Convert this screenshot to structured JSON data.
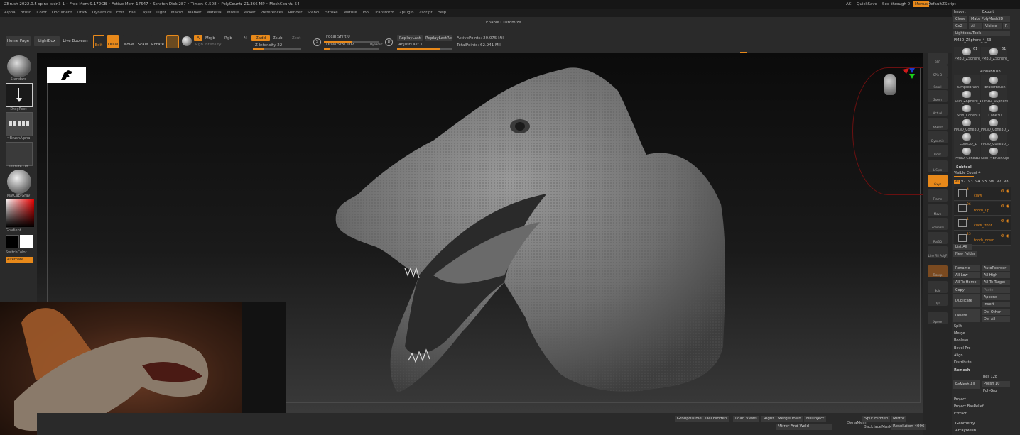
{
  "titlebar": {
    "text": "ZBrush 2022.0.5    spino_skin3-1    • Free Mem 9.172GB • Active Mem 17547 • Scratch Disk 287 • Timer▸ 0.508 • PolyCount▸ 21.366 MP • MeshCount▸ 54",
    "ac": "AC",
    "quicksave": "QuickSave",
    "see_through": "See-through 0",
    "menus": "Menus",
    "default_script": "DefaultZScript"
  },
  "menubar": [
    "Alpha",
    "Brush",
    "Color",
    "Document",
    "Draw",
    "Dynamics",
    "Edit",
    "File",
    "Layer",
    "Light",
    "Macro",
    "Marker",
    "Material",
    "Movie",
    "Picker",
    "Preferences",
    "Render",
    "Stencil",
    "Stroke",
    "Texture",
    "Tool",
    "Transform",
    "Zplugin",
    "Zscript",
    "Help"
  ],
  "enable_customize": "Enable Customize",
  "toolbar": {
    "home_page": "Home Page",
    "lightbox": "LightBox",
    "live_boolean": "Live Boolean",
    "edit": "Edit",
    "draw": "Draw",
    "move": "Move",
    "scale": "Scale",
    "rotate": "Rotate",
    "a": "A",
    "mrgb": "Mrgb",
    "rgb": "Rgb",
    "m": "M",
    "zadd": "Zadd",
    "zsub": "Zsub",
    "zcut": "Zcut",
    "rgb_intensity": "Rgb Intensity",
    "z_intensity": "Z Intensity 22",
    "z_intensity_value": 0.22,
    "focal_shift": "Focal Shift 0",
    "draw_size": "Draw Size 102",
    "dynamic": "Dynamic",
    "replay_last": "ReplayLast",
    "replay_last_rel": "ReplayLastRel",
    "adjust_last": "AdjustLast 1",
    "active_points": "ActivePoints: 20.075 Mil",
    "total_points": "TotalPoints: 62.941 Mil",
    "s": "S",
    "d": "D"
  },
  "left_shelf": {
    "standard": "Standard",
    "drag_rect": "DragRect",
    "brush_alpha": "~BrushAlpha",
    "texture_off": "Texture Off",
    "matcap": "MatCap Gray",
    "gradient": "Gradient",
    "switch_color": "SwitchColor",
    "alternate": "Alternate"
  },
  "right_shelf": [
    "BPR",
    "SPix 3",
    "Scroll",
    "Zoom",
    "Actual",
    "AAHalf",
    "Dynamic Persp",
    "Floor",
    "L.Sym",
    "Gxyz",
    "Frame",
    "Move",
    "Zoom3D",
    "Rot3D",
    "Line Fill PolyF",
    "Transp",
    "Solo",
    "Dyn",
    "Xpose"
  ],
  "panel": {
    "import": "Import",
    "export": "Export",
    "clone": "Clone",
    "make_polymesh": "Make PolyMesh3D",
    "goz": "GoZ",
    "all": "All",
    "visible": "Visible",
    "r": "R",
    "lightbox_tools": "Lightbox▸Tools",
    "current_tool": "PM3D_ZSphere_4_53",
    "thumbs": [
      "PM3D_ZSphere_",
      "PM3D_ZSphere_",
      "SimpleBrush",
      "EraserBrush",
      "Skin_ZSphere_1",
      "PM3D_ZSphere",
      "Skin_Cone3D",
      "Cone3D",
      "PM3D_Cone3D_1",
      "PM3D_Cone3D_2",
      "Cone3D_1",
      "PM3D_Cone3D_1",
      "PM3D_Cone3D_",
      "Skin_~BrushAlph"
    ],
    "thumb_counts": [
      "61",
      "61"
    ],
    "alphabrush": "AlphaBrush",
    "subtool": "Subtool",
    "visible_count": "Visible Count 4",
    "versions": [
      "V1",
      "V2",
      "V3",
      "V4",
      "V5",
      "V6",
      "V7",
      "V8"
    ],
    "subtools": [
      {
        "num": "4",
        "name": "claw"
      },
      {
        "num": "26",
        "name": "tooth_up"
      },
      {
        "num": "1",
        "name": "claw_front"
      },
      {
        "num": "25",
        "name": "tooth_down"
      }
    ],
    "list_all": "List All",
    "new_folder": "New Folder",
    "rename": "Rename",
    "auto_reorder": "AutoReorder",
    "all_low": "All Low",
    "all_high": "All High",
    "all_to_home": "All To Home",
    "all_to_target": "All To Target",
    "copy": "Copy",
    "paste": "Paste",
    "duplicate": "Duplicate",
    "append": "Append",
    "insert": "Insert",
    "delete": "Delete",
    "del_other": "Del Other",
    "del_all": "Del All",
    "split": "Split",
    "merge": "Merge",
    "boolean": "Boolean",
    "bevel_pro": "Bevel Pro",
    "align": "Align",
    "distribute": "Distribute",
    "remesh": "Remesh",
    "remesh_all": "ReMesh All",
    "res": "Res 128",
    "polish": "Polish 10",
    "polygrp": "PolyGrp",
    "project": "Project",
    "project_bas_relief": "Project BasRelief",
    "extract": "Extract",
    "geometry": "Geometry",
    "arraymesh": "ArrayMesh"
  },
  "bottom": {
    "group_visible": "GroupVisible",
    "del_hidden": "Del Hidden",
    "load_views": "Load Views",
    "right": "Right",
    "merge_down": "MergeDown",
    "fill_object": "FillObject",
    "mirror_and_weld": "Mirror And Weld",
    "dynamesh": "DynaMesh",
    "split_hidden": "Split Hidden",
    "mirror": "Mirror",
    "backface_mask": "BackfaceMask",
    "resolution": "Resolution 4096"
  },
  "colors": {
    "accent": "#e8891a",
    "bg": "#2a2a2a"
  }
}
